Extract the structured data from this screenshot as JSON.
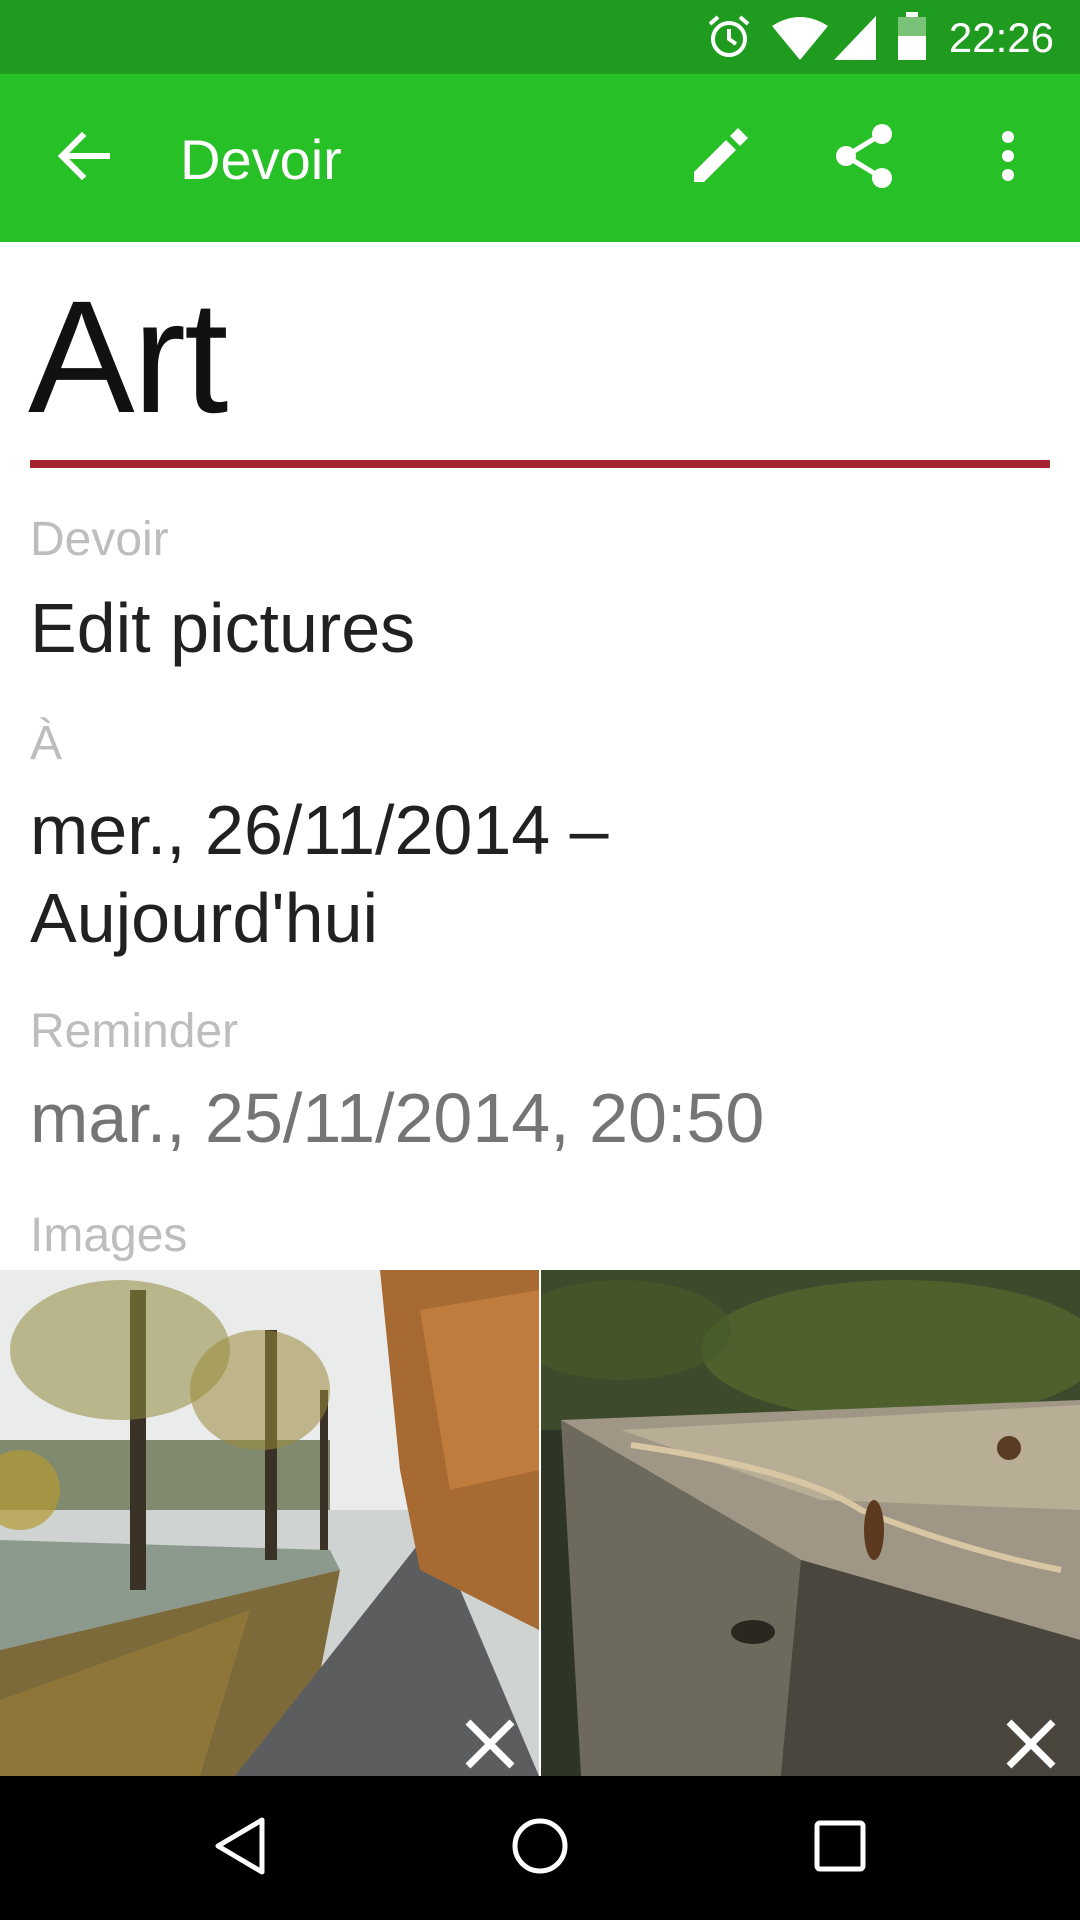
{
  "status_bar": {
    "time": "22:26",
    "icons": [
      "alarm-icon",
      "wifi-icon",
      "signal-icon",
      "battery-icon"
    ]
  },
  "app_bar": {
    "title": "Devoir",
    "actions": [
      "back-arrow-icon",
      "edit-pencil-icon",
      "share-icon",
      "more-vert-icon"
    ],
    "color": "#27c027"
  },
  "detail": {
    "subject": "Art",
    "subject_color": "#a6242f",
    "homework_label": "Devoir",
    "homework_value": "Edit pictures",
    "due_label": "À",
    "due_value_line1": "mer., 26/11/2014 –",
    "due_value_line2": "Aujourd'hui",
    "reminder_label": "Reminder",
    "reminder_value": "mar., 25/11/2014, 20:50",
    "images_label": "Images"
  },
  "images": [
    {
      "subject": "tree-lined canal path in autumn"
    },
    {
      "subject": "close-up of weathered wooden planks with nail"
    }
  ],
  "nav_bar": {
    "buttons": [
      "back-triangle-icon",
      "home-circle-icon",
      "recents-square-icon"
    ]
  }
}
